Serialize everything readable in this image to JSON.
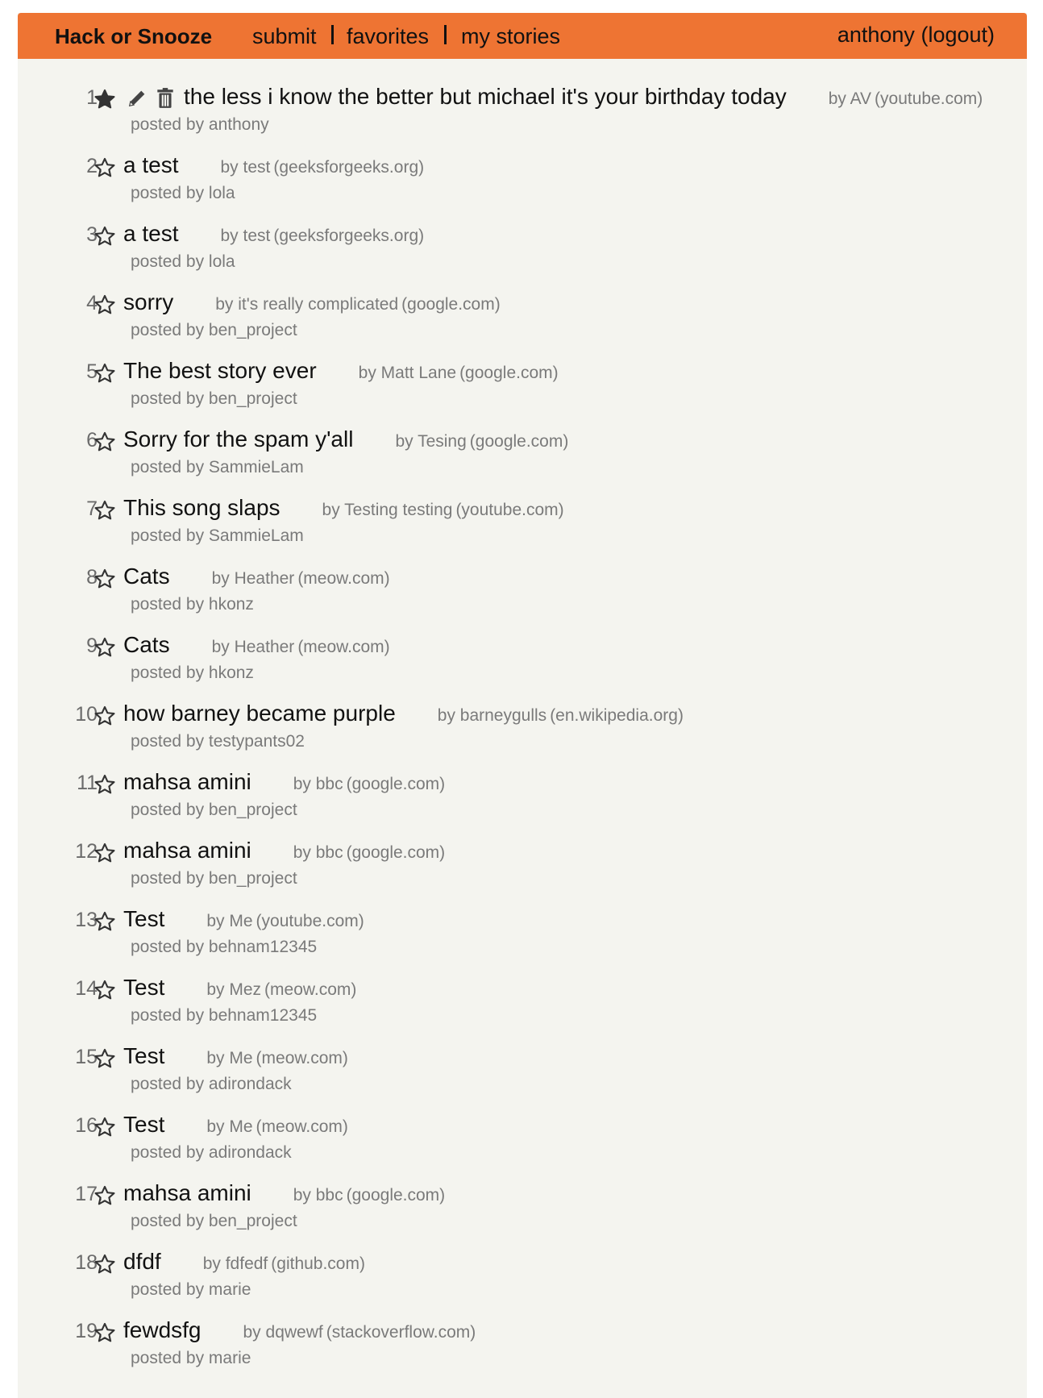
{
  "nav": {
    "brand": "Hack or Snooze",
    "links": [
      "submit",
      "favorites",
      "my stories"
    ],
    "username": "anthony",
    "logout": "(logout)"
  },
  "stories": [
    {
      "num": "1.",
      "favorite": true,
      "own": true,
      "title": "the less i know the better but michael it's your birthday today",
      "by": "by AV",
      "host": "(youtube.com)",
      "poster": "posted by anthony"
    },
    {
      "num": "2.",
      "title": "a test",
      "by": "by test",
      "host": "(geeksforgeeks.org)",
      "poster": "posted by lola"
    },
    {
      "num": "3.",
      "title": "a test",
      "by": "by test",
      "host": "(geeksforgeeks.org)",
      "poster": "posted by lola"
    },
    {
      "num": "4.",
      "title": "sorry",
      "by": "by it's really complicated",
      "host": "(google.com)",
      "poster": "posted by ben_project"
    },
    {
      "num": "5.",
      "title": "The best story ever",
      "by": "by Matt Lane",
      "host": "(google.com)",
      "poster": "posted by ben_project"
    },
    {
      "num": "6.",
      "title": "Sorry for the spam y'all",
      "by": "by Tesing",
      "host": "(google.com)",
      "poster": "posted by SammieLam"
    },
    {
      "num": "7.",
      "title": "This song slaps",
      "by": "by Testing testing",
      "host": "(youtube.com)",
      "poster": "posted by SammieLam"
    },
    {
      "num": "8.",
      "title": "Cats",
      "by": "by Heather",
      "host": "(meow.com)",
      "poster": "posted by hkonz"
    },
    {
      "num": "9.",
      "title": "Cats",
      "by": "by Heather",
      "host": "(meow.com)",
      "poster": "posted by hkonz"
    },
    {
      "num": "10.",
      "title": "how barney became purple",
      "by": "by barneygulls",
      "host": "(en.wikipedia.org)",
      "poster": "posted by testypants02"
    },
    {
      "num": "11.",
      "title": "mahsa amini",
      "by": "by bbc",
      "host": "(google.com)",
      "poster": "posted by ben_project"
    },
    {
      "num": "12.",
      "title": "mahsa amini",
      "by": "by bbc",
      "host": "(google.com)",
      "poster": "posted by ben_project"
    },
    {
      "num": "13.",
      "title": "Test",
      "by": "by Me",
      "host": "(youtube.com)",
      "poster": "posted by behnam12345"
    },
    {
      "num": "14.",
      "title": "Test",
      "by": "by Mez",
      "host": "(meow.com)",
      "poster": "posted by behnam12345"
    },
    {
      "num": "15.",
      "title": "Test",
      "by": "by Me",
      "host": "(meow.com)",
      "poster": "posted by adirondack"
    },
    {
      "num": "16.",
      "title": "Test",
      "by": "by Me",
      "host": "(meow.com)",
      "poster": "posted by adirondack"
    },
    {
      "num": "17.",
      "title": "mahsa amini",
      "by": "by bbc",
      "host": "(google.com)",
      "poster": "posted by ben_project"
    },
    {
      "num": "18.",
      "title": "dfdf",
      "by": "by fdfedf",
      "host": "(github.com)",
      "poster": "posted by marie"
    },
    {
      "num": "19.",
      "title": "fewdsfg",
      "by": "by dqwewf",
      "host": "(stackoverflow.com)",
      "poster": "posted by marie"
    }
  ],
  "icons": {
    "favorite": "star-filled-icon",
    "unfavorite": "star-outline-icon",
    "edit": "pencil-icon",
    "delete": "trash-icon"
  },
  "colors": {
    "navbar": "#ee7433",
    "background": "#f4f4ef",
    "muted": "#7a7a7a"
  }
}
